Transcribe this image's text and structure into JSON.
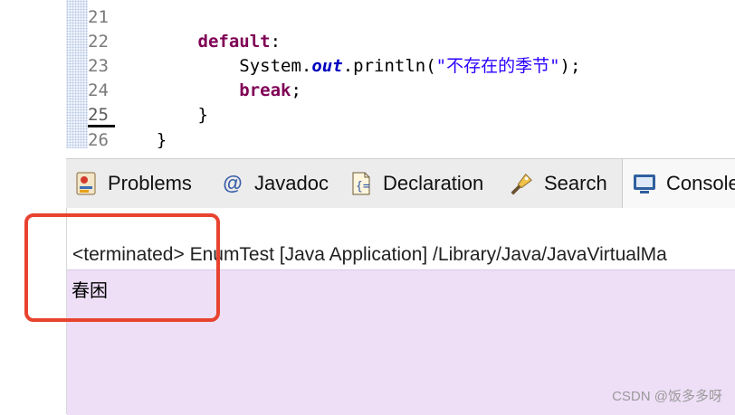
{
  "editor": {
    "lines": [
      {
        "num": "21",
        "indent": "",
        "parts": []
      },
      {
        "num": "22",
        "indent": "        ",
        "parts": [
          {
            "t": "kw",
            "v": "default"
          },
          {
            "t": "n",
            "v": ":"
          }
        ]
      },
      {
        "num": "23",
        "indent": "            ",
        "parts": [
          {
            "t": "n",
            "v": "System."
          },
          {
            "t": "fld",
            "v": "out"
          },
          {
            "t": "n",
            "v": ".println("
          },
          {
            "t": "str",
            "v": "\"不存在的季节\""
          },
          {
            "t": "n",
            "v": ");"
          }
        ]
      },
      {
        "num": "24",
        "indent": "            ",
        "parts": [
          {
            "t": "kw",
            "v": "break"
          },
          {
            "t": "n",
            "v": ";"
          }
        ]
      },
      {
        "num": "25",
        "indent": "        ",
        "parts": [
          {
            "t": "n",
            "v": "}"
          }
        ]
      },
      {
        "num": "26",
        "indent": "    ",
        "parts": [
          {
            "t": "n",
            "v": "}"
          }
        ]
      }
    ],
    "current_line": "25"
  },
  "tabs": [
    {
      "label": "Problems",
      "icon": "problems-icon"
    },
    {
      "label": "Javadoc",
      "icon": "javadoc-icon"
    },
    {
      "label": "Declaration",
      "icon": "declaration-icon"
    },
    {
      "label": "Search",
      "icon": "search-icon"
    },
    {
      "label": "Console",
      "icon": "console-icon"
    }
  ],
  "console": {
    "description": "<terminated> EnumTest [Java Application] /Library/Java/JavaVirtualMa",
    "output": "春困"
  },
  "watermark": "CSDN @饭多多呀",
  "colors": {
    "keyword": "#7f0055",
    "field": "#0000c0",
    "string": "#2a00ff",
    "highlight": "#e8432f",
    "console_bg": "#eedff7"
  }
}
